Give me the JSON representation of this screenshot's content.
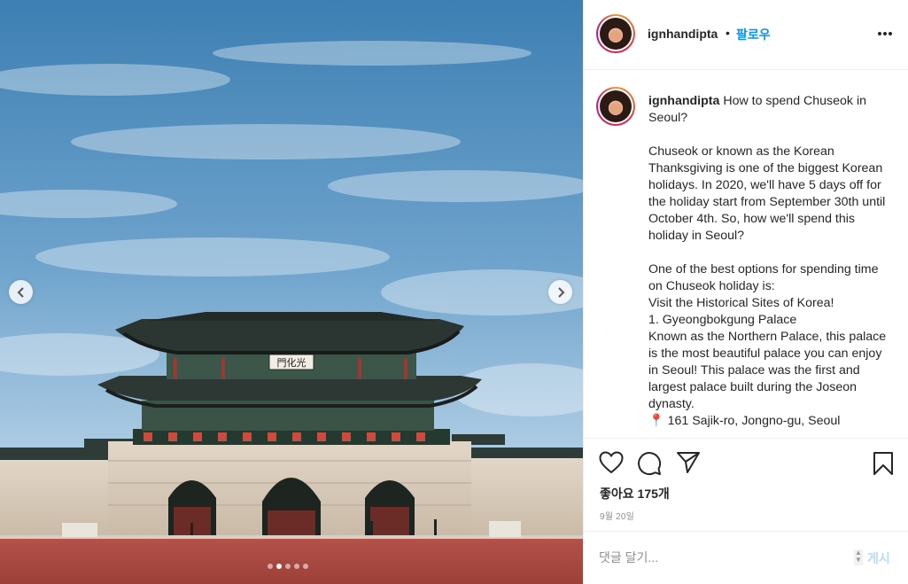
{
  "post": {
    "author": "ignhandipta",
    "follow_separator": "•",
    "follow_label": "팔로우",
    "caption_username": "ignhandipta",
    "caption_text": " How to spend Chuseok in Seoul?\n\nChuseok or known as the Korean Thanksgiving is one of the biggest Korean holidays. In 2020, we'll have 5 days off for the holiday start from September 30th until October 4th. So, how we'll spend this holiday in Seoul?\n\nOne of the best options for spending time on Chuseok holiday is:\nVisit the Historical Sites of Korea!\n1. Gyeongbokgung Palace\nKnown as the Northern Palace, this palace is the most beautiful palace you can enjoy in Seoul! This palace was the first and largest palace built during the Joseon dynasty.\n📍 161 Sajik-ro, Jongno-gu, Seoul",
    "likes": "좋아요 175개",
    "date": "9월 20일",
    "sign_text": "門化光"
  },
  "carousel": {
    "total": 5,
    "active_index": 1
  },
  "comment": {
    "placeholder": "댓글 달기...",
    "post_label": "게시"
  },
  "icons": {
    "prev": "chevron-left-icon",
    "next": "chevron-right-icon",
    "more": "more-options-icon",
    "like": "heart-icon",
    "comment": "comment-icon",
    "share": "share-icon",
    "save": "bookmark-icon"
  },
  "colors": {
    "follow": "#0095f6",
    "post_disabled": "#b3dbff",
    "text": "#262626",
    "muted": "#8e8e8e"
  }
}
